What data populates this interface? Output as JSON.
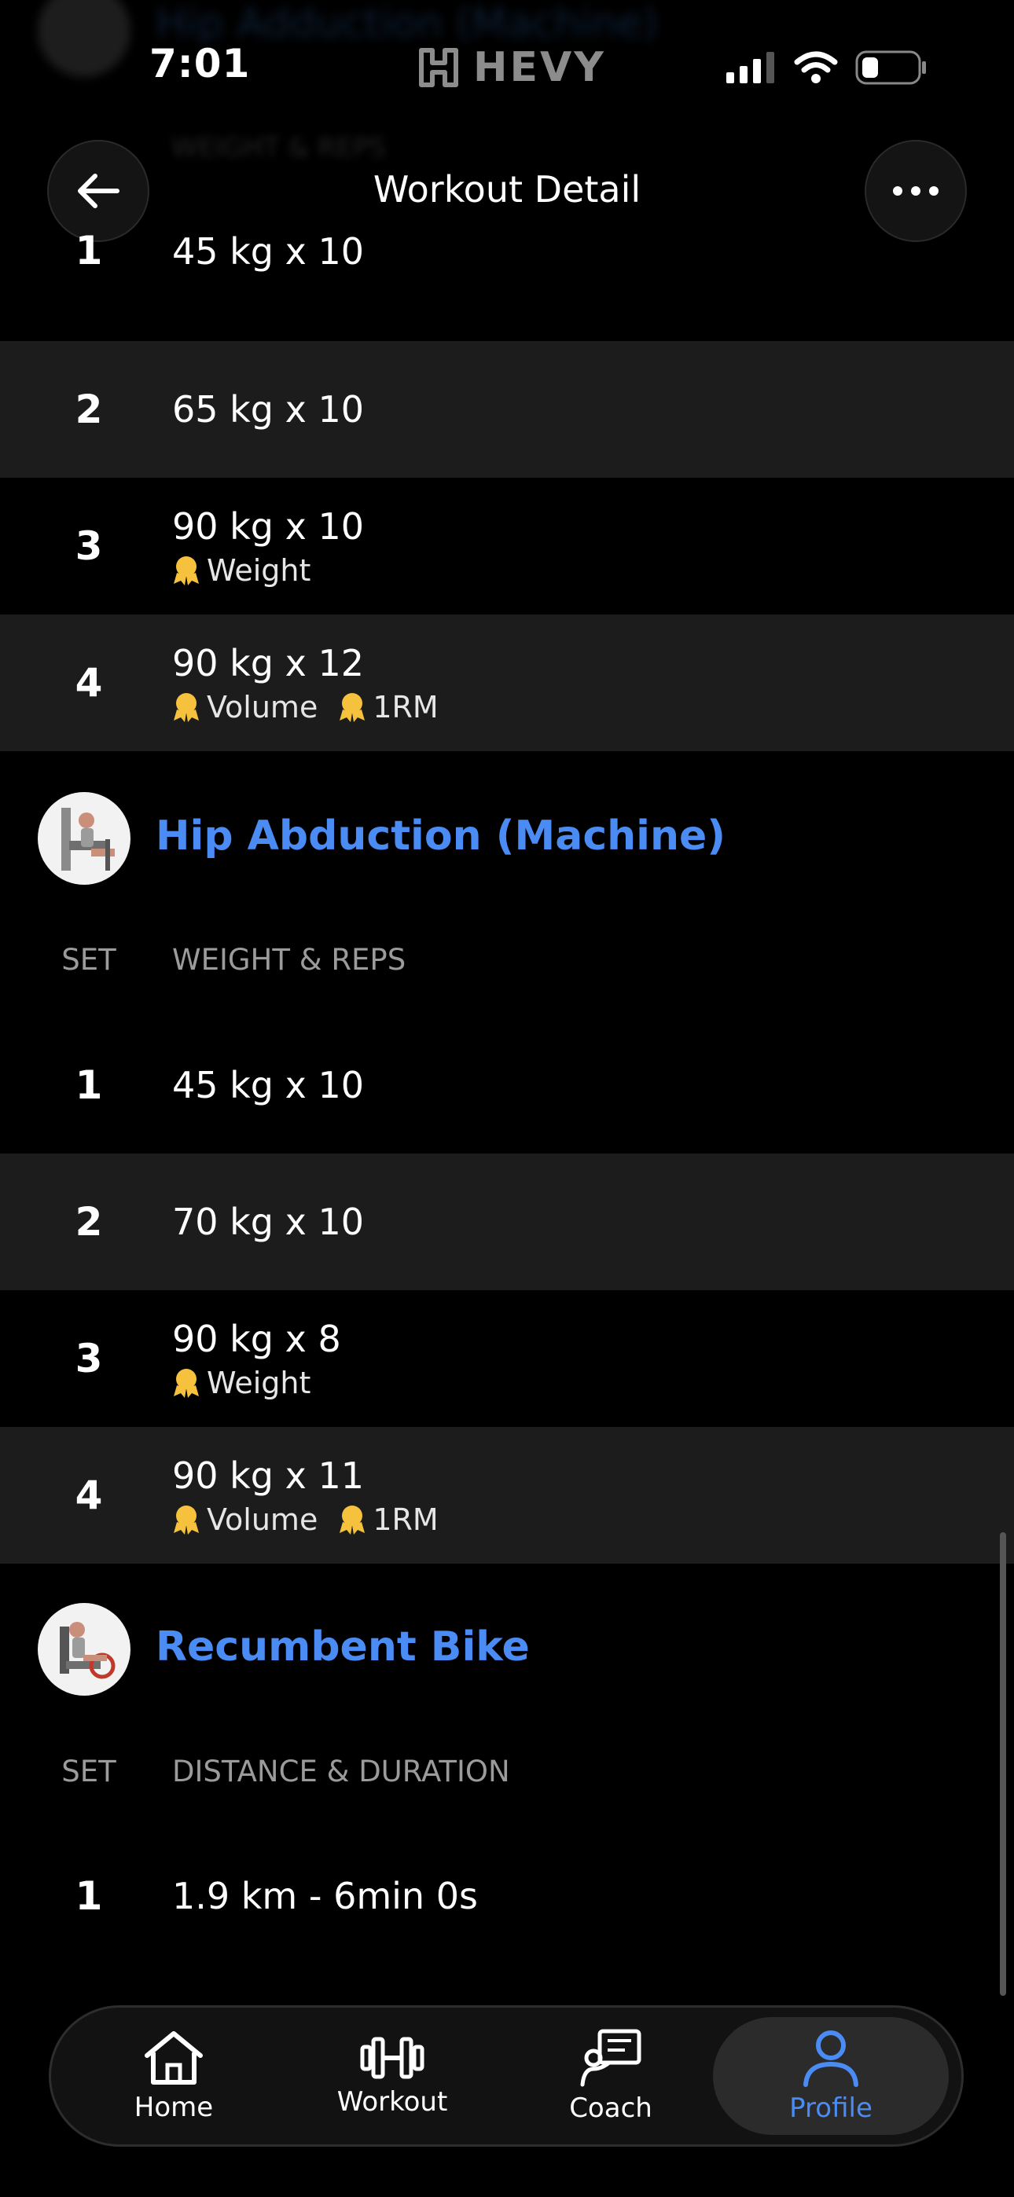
{
  "status": {
    "time": "7:01",
    "logo_text": "HEVY"
  },
  "header": {
    "title": "Workout Detail",
    "ghost_title": "Hip Adduction (Machine)",
    "ghost_subtitle": "WEIGHT & REPS"
  },
  "colors": {
    "accent": "#4a8cf4",
    "medal": "#f6c23e",
    "alt_row": "#1c1c1c"
  },
  "exercises": [
    {
      "name": "",
      "sets": [
        {
          "num": "1",
          "value": "45 kg x 10",
          "badges": []
        },
        {
          "num": "2",
          "value": "65 kg x 10",
          "badges": []
        },
        {
          "num": "3",
          "value": "90 kg x 10",
          "badges": [
            "Weight"
          ]
        },
        {
          "num": "4",
          "value": "90 kg x 12",
          "badges": [
            "Volume",
            "1RM"
          ]
        }
      ]
    },
    {
      "name": "Hip Abduction (Machine)",
      "columns": [
        "SET",
        "WEIGHT & REPS"
      ],
      "sets": [
        {
          "num": "1",
          "value": "45 kg x 10",
          "badges": []
        },
        {
          "num": "2",
          "value": "70 kg x 10",
          "badges": []
        },
        {
          "num": "3",
          "value": "90 kg x 8",
          "badges": [
            "Weight"
          ]
        },
        {
          "num": "4",
          "value": "90 kg x 11",
          "badges": [
            "Volume",
            "1RM"
          ]
        }
      ]
    },
    {
      "name": "Recumbent Bike",
      "columns": [
        "SET",
        "DISTANCE & DURATION"
      ],
      "sets": [
        {
          "num": "1",
          "value": "1.9 km - 6min 0s",
          "badges": []
        }
      ]
    }
  ],
  "tabs": [
    {
      "label": "Home",
      "icon": "home-icon",
      "active": false
    },
    {
      "label": "Workout",
      "icon": "dumbbell-icon",
      "active": false
    },
    {
      "label": "Coach",
      "icon": "coach-icon",
      "active": false
    },
    {
      "label": "Profile",
      "icon": "profile-icon",
      "active": true
    }
  ]
}
